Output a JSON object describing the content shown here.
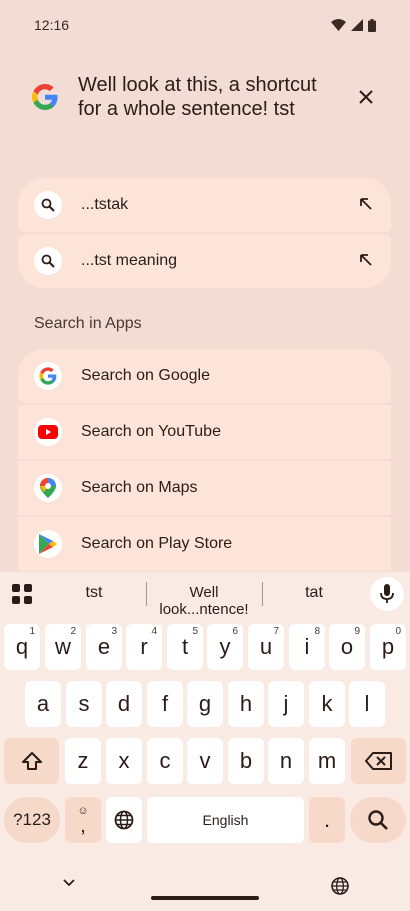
{
  "status_bar": {
    "time": "12:16"
  },
  "search": {
    "query": "Well look at this, a shortcut for a whole sentence! tst"
  },
  "suggestions": [
    {
      "text": "...tstak"
    },
    {
      "text": "...tst meaning"
    }
  ],
  "search_in_apps": {
    "heading": "Search in Apps",
    "items": [
      {
        "label": "Search on Google"
      },
      {
        "label": "Search on YouTube"
      },
      {
        "label": "Search on Maps"
      },
      {
        "label": "Search on Play Store"
      }
    ]
  },
  "keyboard": {
    "suggestions": [
      "tst",
      "Well look...ntence!",
      "tat"
    ],
    "row1": [
      {
        "key": "q",
        "hint": "1"
      },
      {
        "key": "w",
        "hint": "2"
      },
      {
        "key": "e",
        "hint": "3"
      },
      {
        "key": "r",
        "hint": "4"
      },
      {
        "key": "t",
        "hint": "5"
      },
      {
        "key": "y",
        "hint": "6"
      },
      {
        "key": "u",
        "hint": "7"
      },
      {
        "key": "i",
        "hint": "8"
      },
      {
        "key": "o",
        "hint": "9"
      },
      {
        "key": "p",
        "hint": "0"
      }
    ],
    "row2": [
      "a",
      "s",
      "d",
      "f",
      "g",
      "h",
      "j",
      "k",
      "l"
    ],
    "row3": [
      "z",
      "x",
      "c",
      "v",
      "b",
      "n",
      "m"
    ],
    "symbols_label": "?123",
    "comma_label": ",",
    "space_label": "English",
    "period_label": "."
  },
  "colors": {
    "background": "#f2dcd3",
    "card": "#fde4d9",
    "keyboard_bg": "#f9ebe4",
    "modifier_key": "#f6d9c9"
  }
}
